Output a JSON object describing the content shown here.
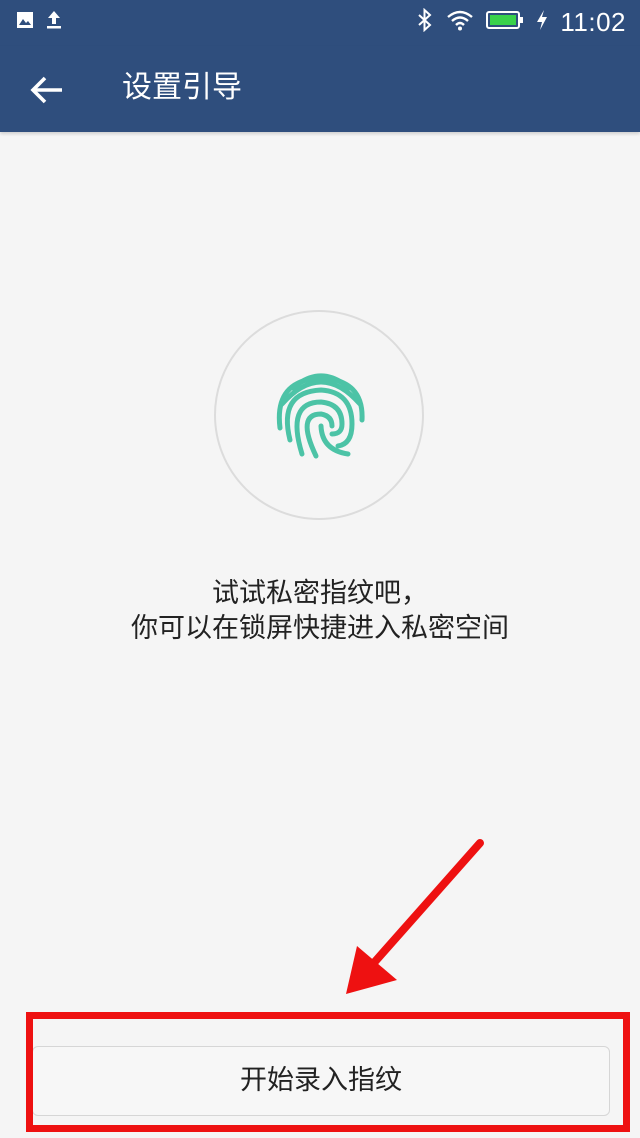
{
  "status_bar": {
    "time": "11:02",
    "icons": [
      "image-icon",
      "upload-icon",
      "bluetooth-icon",
      "wifi-icon",
      "battery-icon",
      "charging-icon"
    ],
    "battery_color": "#39d14b"
  },
  "app_bar": {
    "title": "设置引导",
    "back_icon": "back-arrow-icon",
    "background": "#2f4e7d"
  },
  "content": {
    "fingerprint_icon": "fingerprint-icon",
    "fingerprint_color": "#4cc3a6",
    "message_line1": "试试私密指纹吧，",
    "message_line2": "你可以在锁屏快捷进入私密空间"
  },
  "footer": {
    "start_button_label": "开始录入指纹"
  },
  "annotation": {
    "color": "#ee1111"
  }
}
